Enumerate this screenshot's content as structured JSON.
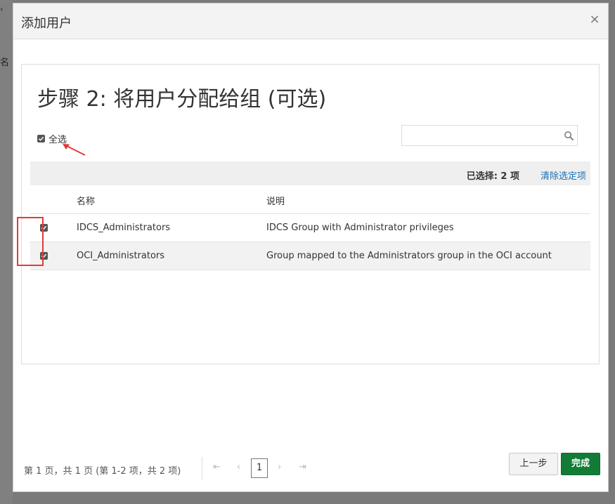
{
  "background": {
    "left_text": "名"
  },
  "dialog": {
    "title": "添加用户",
    "close_label": "×"
  },
  "step": {
    "title": "步骤 2: 将用户分配给组 (可选)"
  },
  "select_all": {
    "label": "全选",
    "checked": true
  },
  "search": {
    "placeholder": "",
    "value": ""
  },
  "selection": {
    "count_label": "已选择: 2 项",
    "clear_label": "清除选定项"
  },
  "table": {
    "headers": {
      "name": "名称",
      "description": "说明"
    },
    "rows": [
      {
        "name": "IDCS_Administrators",
        "description": "IDCS Group with Administrator privileges",
        "checked": true
      },
      {
        "name": "OCI_Administrators",
        "description": "Group mapped to the Administrators group in the OCI account",
        "checked": true
      }
    ]
  },
  "pagination": {
    "info": "第  1  页，共 1 页  (第 1-2 项，共 2 项)",
    "first": "⇤",
    "prev": "‹",
    "current": "1",
    "next": "›",
    "last": "⇥"
  },
  "footer": {
    "back_label": "上一步",
    "finish_label": "完成"
  },
  "colors": {
    "accent_green": "#127c36",
    "link_blue": "#1a6fb3",
    "annotation_red": "#e23a3a"
  }
}
